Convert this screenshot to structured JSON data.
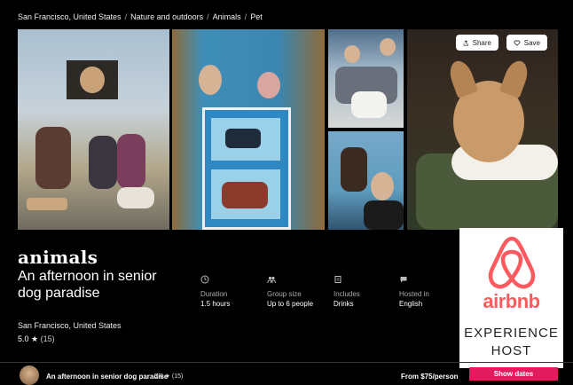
{
  "breadcrumb": [
    "San Francisco, United States",
    "Nature and outdoors",
    "Animals",
    "Pet"
  ],
  "actions": {
    "share_label": "Share",
    "save_label": "Save"
  },
  "header": {
    "category": "animals",
    "title": "An afternoon in senior dog paradise",
    "location": "San Francisco, United States",
    "rating": "5.0",
    "review_count": "(15)"
  },
  "details": [
    {
      "icon": "clock-icon",
      "label": "Duration",
      "value": "1.5 hours"
    },
    {
      "icon": "group-icon",
      "label": "Group size",
      "value": "Up to 6 people"
    },
    {
      "icon": "drink-icon",
      "label": "Includes",
      "value": "Drinks"
    },
    {
      "icon": "chat-icon",
      "label": "Hosted in",
      "value": "English"
    }
  ],
  "badge": {
    "wordmark": "airbnb",
    "line1": "EXPERIENCE",
    "line2": "HOST"
  },
  "footer": {
    "title": "An afternoon in senior dog paradise",
    "rating": "5.0 ★ (15)",
    "price": "From $75/person",
    "cta": "Show dates"
  },
  "colors": {
    "accent": "#e31c5f",
    "brand": "#ff5a5f",
    "background": "#000000"
  }
}
